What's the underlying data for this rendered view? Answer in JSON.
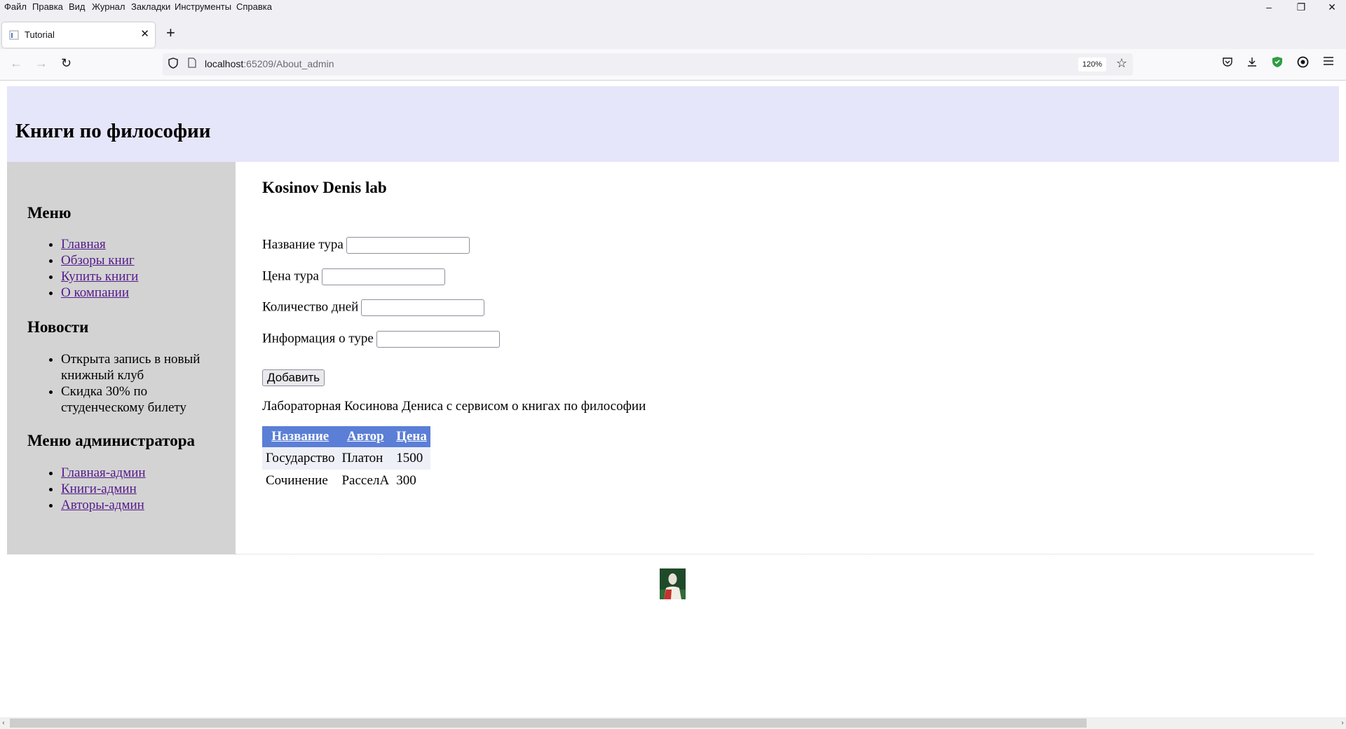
{
  "browser": {
    "menu": [
      "Файл",
      "Правка",
      "Вид",
      "Журнал",
      "Закладки",
      "Инструменты",
      "Справка"
    ],
    "tab_title": "Tutorial",
    "url_host": "localhost",
    "url_rest": ":65209/About_admin",
    "zoom": "120%",
    "window_controls": {
      "minimize": "–",
      "restore": "❐",
      "close": "✕"
    }
  },
  "site": {
    "title": "Книги по философии"
  },
  "sidebar": {
    "menu_title": "Меню",
    "menu_items": [
      "Главная",
      "Обзоры книг",
      "Купить книги",
      "О компании"
    ],
    "news_title": "Новости",
    "news_items": [
      "Открыта запись в новый книжный клуб",
      "Скидка 30% по студенческому билету"
    ],
    "admin_title": "Меню администратора",
    "admin_items": [
      "Главная-админ",
      "Книги-админ",
      "Авторы-админ"
    ]
  },
  "main": {
    "lab_title": "Kosinov Denis lab",
    "fields": [
      {
        "label": "Название тура",
        "value": ""
      },
      {
        "label": "Цена тура",
        "value": ""
      },
      {
        "label": "Количество дней",
        "value": ""
      },
      {
        "label": "Информация о туре",
        "value": ""
      }
    ],
    "add_button": "Добавить",
    "description": "Лабораторная Косинова Дениса с сервисом о книгах по философии",
    "table": {
      "headers": [
        "Название",
        "Автор",
        "Цена"
      ],
      "rows": [
        [
          "Государство",
          "Платон",
          "1500"
        ],
        [
          "Сочинение",
          "РасселА",
          "300"
        ]
      ]
    }
  },
  "colors": {
    "header_bg": "#e6e6fa",
    "sidebar_bg": "#d3d3d3",
    "table_header_bg": "#5b7fd6",
    "link_visited": "#551a8b"
  }
}
